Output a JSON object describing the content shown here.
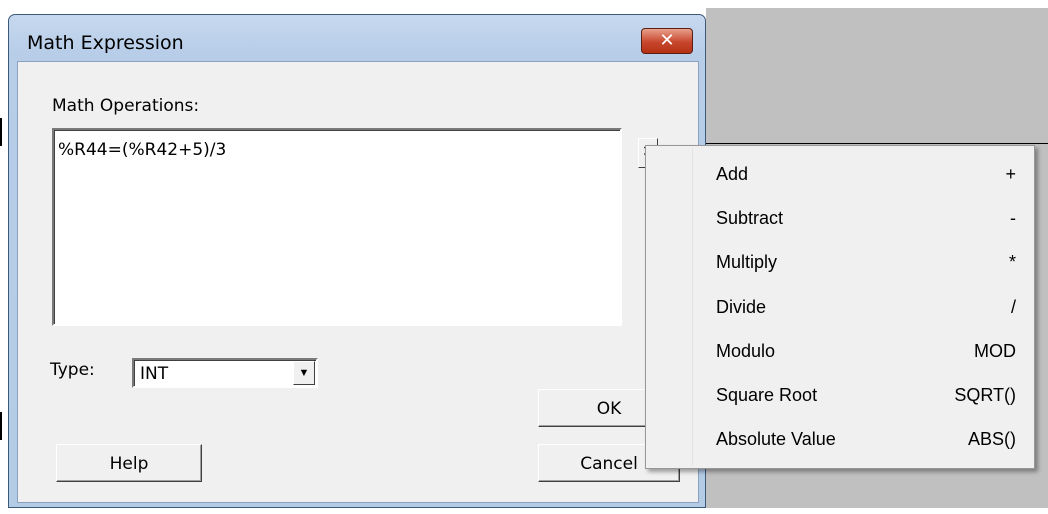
{
  "dialog": {
    "title": "Math Expression",
    "close_glyph": "✕",
    "operations_label": "Math Operations:",
    "expression": "%R44=(%R42+5)/3",
    "menu_arrow_glyph": ">",
    "type_label": "Type:",
    "type_value": "INT",
    "ok_label": "OK",
    "help_label": "Help",
    "cancel_label": "Cancel"
  },
  "menu": {
    "items": [
      {
        "label": "Add",
        "shortcut": "+"
      },
      {
        "label": "Subtract",
        "shortcut": "-"
      },
      {
        "label": "Multiply",
        "shortcut": "*"
      },
      {
        "label": "Divide",
        "shortcut": "/"
      },
      {
        "label": "Modulo",
        "shortcut": "MOD"
      },
      {
        "label": "Square Root",
        "shortcut": "SQRT()"
      },
      {
        "label": "Absolute Value",
        "shortcut": "ABS()"
      }
    ]
  }
}
